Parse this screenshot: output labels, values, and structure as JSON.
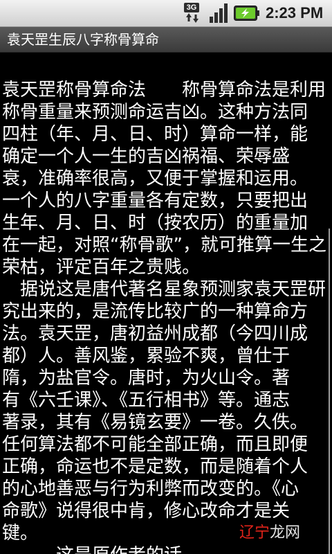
{
  "status_bar": {
    "network_type": "3G",
    "time": "2:23 PM"
  },
  "title_bar": {
    "title": "袁天罡生辰八字称骨算命"
  },
  "article": {
    "lines": [
      "袁天罡称骨算命法　　称骨算命法是利用",
      "称骨重量来预测命运吉凶。这种方法同",
      "四柱（年、月、日、时）算命一样，能",
      "确定一个人一生的吉凶祸福、荣辱盛",
      "衰，准确率很高，又便于掌握和运用。",
      "一个人的八字重量各有定数，只要把出",
      "生年、月、日、时（按农历）的重量加",
      "在一起，对照“称骨歌”，就可推算一生之",
      "荣枯，评定百年之贵贱。",
      "　据说这是唐代著名星象预测家袁天罡研",
      "究出来的，是流传比较广的一种算命方",
      "法。袁天罡，唐初益州成都（今四川成",
      "都）人。善风鉴，累验不爽，曾仕于",
      "隋，为盐官令。唐时，为火山令。著",
      "有《六壬课》、《五行相书》等。通志",
      "著录，其有《易镜玄要》一卷。久佚。",
      "任何算法都不可能全部正确，而且即便",
      "正确，命运也不是定数，而是随着个人",
      "的心地善恶与行为利弊而改变的。《心",
      "命歌》说得很中肯，修心改命才是关",
      "键。",
      "　　　这是原作者的话"
    ]
  },
  "watermark": {
    "part1": "辽宁",
    "part2": "龙网"
  }
}
